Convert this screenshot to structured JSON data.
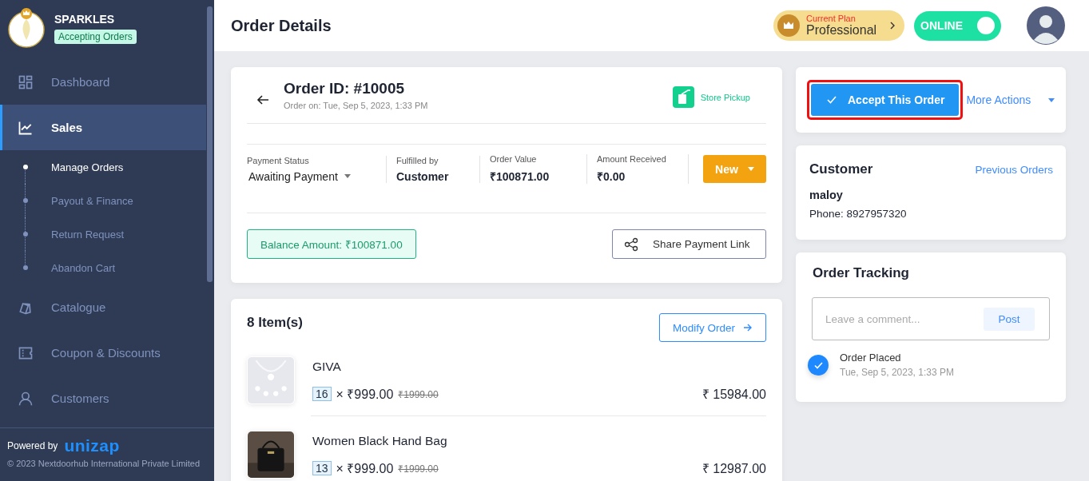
{
  "sidebar": {
    "store_name": "SPARKLES",
    "store_status": "Accepting Orders",
    "nav": [
      {
        "label": "Dashboard",
        "selected": false
      },
      {
        "label": "Sales",
        "selected": true,
        "expanded": true,
        "children": [
          {
            "label": "Manage Orders",
            "selected": true
          },
          {
            "label": "Payout & Finance",
            "selected": false
          },
          {
            "label": "Return Request",
            "selected": false
          },
          {
            "label": "Abandon Cart",
            "selected": false
          }
        ]
      },
      {
        "label": "Catalogue",
        "selected": false
      },
      {
        "label": "Coupon & Discounts",
        "selected": false
      },
      {
        "label": "Customers",
        "selected": false
      }
    ],
    "powered_by": "Powered by",
    "brand": "unizap",
    "copyright": "© 2023 Nextdoorhub International Private Limited"
  },
  "header": {
    "title": "Order Details",
    "plan": {
      "label": "Current Plan",
      "name": "Professional"
    },
    "status_toggle": {
      "label": "ONLINE",
      "on": true
    }
  },
  "order": {
    "order_id": "Order ID: #10005",
    "order_date": "Order on: Tue, Sep 5, 2023, 1:33 PM",
    "delivery_type": "Store Pickup",
    "stats": [
      {
        "label": "Payment Status",
        "value": "Awaiting Payment",
        "kind": "dropdown"
      },
      {
        "label": "Fulfilled by",
        "value": "Customer",
        "kind": "text"
      },
      {
        "label": "Order Value",
        "value": "₹100871.00",
        "kind": "text"
      },
      {
        "label": "Amount Received",
        "value": "₹0.00",
        "kind": "text"
      }
    ],
    "status_button": "New",
    "balance": "Balance Amount: ₹100871.00",
    "share_button": "Share Payment Link"
  },
  "items": {
    "title": "8 Item(s)",
    "modify_button": "Modify Order",
    "list": [
      {
        "name": "GIVA",
        "quantity": "16",
        "price": "× ₹999.00",
        "mrp": "₹1999.00",
        "total": "₹ 15984.00",
        "kind": "picture"
      },
      {
        "name": "Women Black Hand Bag",
        "quantity": "13",
        "price": "× ₹999.00",
        "mrp": "₹1999.00",
        "total": "₹ 12987.00",
        "kind": "picture"
      }
    ]
  },
  "actions": {
    "accept_button": "Accept This Order",
    "highlighted": true,
    "more_actions": "More Actions"
  },
  "customer": {
    "title": "Customer",
    "link": "Previous Orders",
    "name": "maloy",
    "phone": "Phone: 8927957320"
  },
  "tracking": {
    "title": "Order Tracking",
    "comment_placeholder": "Leave a comment...",
    "post_button": "Post",
    "events": [
      {
        "title": "Order Placed",
        "time": "Tue, Sep 5, 2023, 1:33 PM",
        "done": true
      }
    ]
  }
}
